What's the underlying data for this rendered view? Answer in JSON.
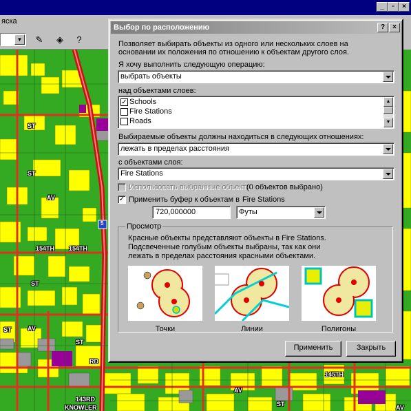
{
  "app": {
    "menu_partial": "яска"
  },
  "map": {
    "road_labels": [
      "154TH",
      "154TH",
      "RD",
      "145TH",
      "143RD",
      "KNOWLER",
      "AV",
      "ST",
      "ST",
      "ST",
      "ST",
      "ST",
      "AV",
      "AV",
      "ST",
      "AV"
    ],
    "highway_shield": "5"
  },
  "dialog": {
    "title": "Выбор по расположению",
    "help_btn": "?",
    "close_btn": "×",
    "intro_line1": "Позволяет выбирать объекты из одного или нескольких слоев на",
    "intro_line2": "основании их положения по отношению к объектам другого слоя.",
    "operation_label": "Я хочу выполнить следующую операцию:",
    "operation_value": "выбрать объекты",
    "layers_label": "над объектами слоев:",
    "layers": [
      {
        "name": "Schools",
        "checked": true
      },
      {
        "name": "Fire Stations",
        "checked": false
      },
      {
        "name": "Roads",
        "checked": false
      }
    ],
    "relation_label": "Выбираемые объекты должны находиться в следующих отношениях:",
    "relation_value": "лежать в пределах расстояния",
    "source_layer_label": "с объектами слоя:",
    "source_layer_value": "Fire Stations",
    "use_selected_label": "Использовать выбранные объекты",
    "use_selected_count": "(0 объектов выбрано)",
    "buffer_label": "Применить буфер к объектам в",
    "buffer_layer": "Fire Stations",
    "buffer_value": "720,000000",
    "buffer_units": "Футы",
    "preview_label": "Просмотр",
    "preview_line1": "Красные объекты представляют объекты в  Fire Stations.",
    "preview_line2": "Подсвеченные голубым объекты выбраны, так как они",
    "preview_line3": "лежать в пределах расстояния красными объектами.",
    "preview_captions": [
      "Точки",
      "Линии",
      "Полигоны"
    ],
    "apply_button": "Применить",
    "close_button": "Закрыть"
  },
  "colors": {
    "titlebar_inactive_start": "#7f7f7f",
    "map_yellow": "#ffff00",
    "map_green": "#66cc00",
    "road_red": "#e03020",
    "selection_cyan": "#00e0e0"
  }
}
